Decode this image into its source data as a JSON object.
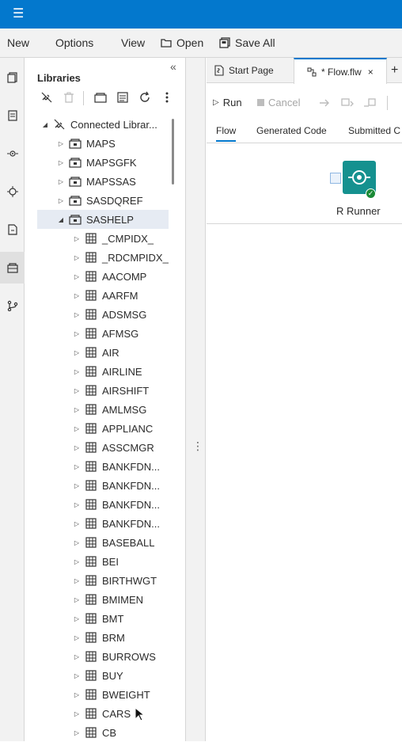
{
  "menubar": {
    "new_label": "New",
    "options_label": "Options",
    "view_label": "View",
    "open_label": "Open",
    "save_all_label": "Save All"
  },
  "libraries": {
    "title": "Libraries",
    "connected_label": "Connected Librar...",
    "libs": [
      {
        "label": "MAPS"
      },
      {
        "label": "MAPSGFK"
      },
      {
        "label": "MAPSSAS"
      },
      {
        "label": "SASDQREF"
      },
      {
        "label": "SASHELP",
        "selected": true
      }
    ],
    "tables": [
      "_CMPIDX_",
      "_RDCMPIDX_",
      "AACOMP",
      "AARFM",
      "ADSMSG",
      "AFMSG",
      "AIR",
      "AIRLINE",
      "AIRSHIFT",
      "AMLMSG",
      "APPLIANC",
      "ASSCMGR",
      "BANKFDN...",
      "BANKFDN...",
      "BANKFDN...",
      "BANKFDN...",
      "BASEBALL",
      "BEI",
      "BIRTHWGT",
      "BMIMEN",
      "BMT",
      "BRM",
      "BURROWS",
      "BUY",
      "BWEIGHT",
      "CARS",
      "CB"
    ]
  },
  "editor": {
    "tabs": [
      {
        "label": "Start Page"
      },
      {
        "label": "* Flow.flw",
        "active": true
      }
    ],
    "run_label": "Run",
    "cancel_label": "Cancel",
    "subtabs": [
      "Flow",
      "Generated Code",
      "Submitted C"
    ],
    "node_label": "R Runner"
  },
  "colors": {
    "accent": "#0378cd",
    "node": "#15918f",
    "success": "#1a8a36"
  }
}
